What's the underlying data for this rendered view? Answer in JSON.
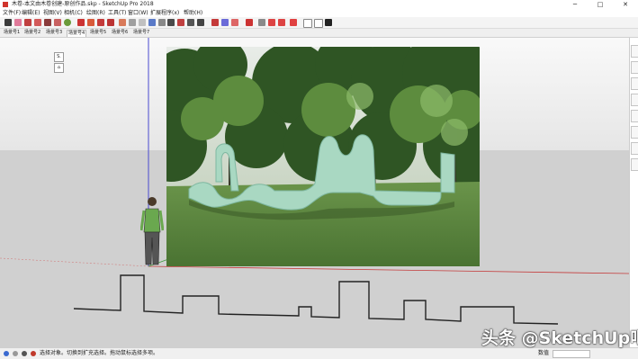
{
  "window": {
    "title": "木卷-本文由木卷创建-原创作品.skp - SketchUp Pro 2018",
    "minimize": "─",
    "maximize": "□",
    "close": "✕"
  },
  "menu": [
    "文件(F)",
    "编辑(E)",
    "视图(V)",
    "相机(C)",
    "绘图(R)",
    "工具(T)",
    "窗口(W)",
    "扩展程序(x)",
    "帮助(H)"
  ],
  "toolbar_icons": [
    "select-icon",
    "eraser-icon",
    "line-icon",
    "arc-icon",
    "rectangle-icon",
    "circle-icon",
    "push-pull-icon",
    "move-icon",
    "rotate-icon",
    "scale-icon",
    "offset-icon",
    "tape-icon",
    "dimension-icon",
    "text-icon",
    "axes-icon",
    "3d-text-icon",
    "orbit-icon",
    "pan-icon",
    "zoom-icon",
    "zoom-extents-icon",
    "paint-icon",
    "components-icon",
    "3d-warehouse-icon",
    "extension-icon",
    "layout-icon",
    "style-icon",
    "folder-icon",
    "save-icon",
    "camera-icon",
    "print-icon",
    "home-icon"
  ],
  "scenes": [
    "场景号1",
    "场景号2",
    "场景号3",
    "场景号4",
    "场景号5",
    "场景号6",
    "场景号7"
  ],
  "active_scene_index": 3,
  "mini_tools": [
    "S.",
    "⌂"
  ],
  "status": {
    "text": "选择对象。切换到扩充选择。拖动鼠标选择多项。",
    "measurement_label": "数值"
  },
  "watermark": "头条 @SketchUp吧",
  "colors": {
    "axis_red": "#c43a3a",
    "axis_blue": "#3a3ac4",
    "axis_green": "#3a9a3a",
    "sculpture": "#a9d8c2",
    "grass": "#5f8a43",
    "tree_dark": "#2f5524",
    "tree_light": "#6a9a4a"
  }
}
